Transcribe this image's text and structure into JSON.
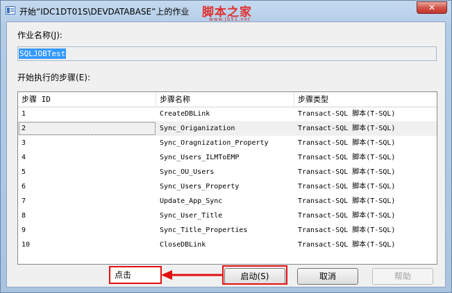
{
  "window": {
    "title": "开始“IDC1DT01S\\DEVDATABASE”上的作业",
    "close_glyph": "✕"
  },
  "watermark": {
    "main": "脚本之家",
    "sub": "www.Jb51.net"
  },
  "form": {
    "job_name_label": "作业名称(J):",
    "job_name_value": "SQLJOBTest",
    "steps_label": "开始执行的步骤(E):"
  },
  "table": {
    "columns": [
      "步骤 ID",
      "步骤名称",
      "步骤类型"
    ],
    "rows": [
      [
        "1",
        "CreateDBLink",
        "Transact-SQL 脚本(T-SQL)"
      ],
      [
        "2",
        "Sync_Origanization",
        "Transact-SQL 脚本(T-SQL)"
      ],
      [
        "3",
        "Sync_Oragnization_Property",
        "Transact-SQL 脚本(T-SQL)"
      ],
      [
        "4",
        "Sync_Users_ILMToEMP",
        "Transact-SQL 脚本(T-SQL)"
      ],
      [
        "5",
        "Sync_OU_Users",
        "Transact-SQL 脚本(T-SQL)"
      ],
      [
        "6",
        "Sync_Users_Property",
        "Transact-SQL 脚本(T-SQL)"
      ],
      [
        "7",
        "Update_App_Sync",
        "Transact-SQL 脚本(T-SQL)"
      ],
      [
        "8",
        "Sync_User_Title",
        "Transact-SQL 脚本(T-SQL)"
      ],
      [
        "9",
        "Sync_Title_Properties",
        "Transact-SQL 脚本(T-SQL)"
      ],
      [
        "10",
        "CloseDBLink",
        "Transact-SQL 脚本(T-SQL)"
      ]
    ],
    "selected_row": 2
  },
  "buttons": {
    "start": "启动(S)",
    "cancel": "取消",
    "help": "帮助"
  },
  "annotation": {
    "label": "点击",
    "color": "#e21010"
  }
}
